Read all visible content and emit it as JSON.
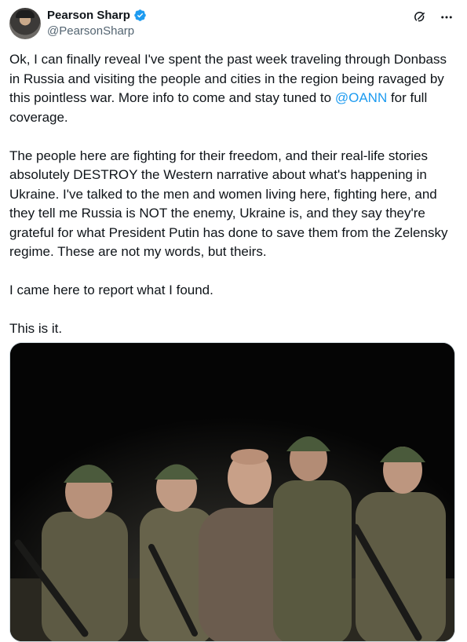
{
  "author": {
    "display_name": "Pearson Sharp",
    "handle": "@PearsonSharp",
    "verified": true,
    "verified_color": "#1d9bf0"
  },
  "actions": {
    "grok_icon": "grok-icon",
    "more_icon": "more-icon"
  },
  "tweet": {
    "p1_before": "Ok, I can finally reveal I've spent the past week traveling through Donbass in Russia and visiting the people and cities in the region being ravaged by this pointless war. More info to come and stay tuned to ",
    "p1_mention": "@OANN",
    "p1_after": " for full coverage.",
    "p2": "The people here are fighting for their freedom, and their real-life stories absolutely DESTROY the Western narrative about what's happening in Ukraine. I've talked to the men and women living here, fighting here, and they tell me Russia is NOT the enemy, Ukraine is, and they say they're grateful for what President Putin has done to save them from the Zelensky regime. These are not my words, but theirs.",
    "p3": "I came here to report what I found.",
    "p4": "This is it."
  },
  "media": {
    "description_icon": "photo-soldiers-at-night"
  },
  "colors": {
    "mention": "#1d9bf0",
    "text": "#0f1419",
    "secondary": "#536471"
  }
}
